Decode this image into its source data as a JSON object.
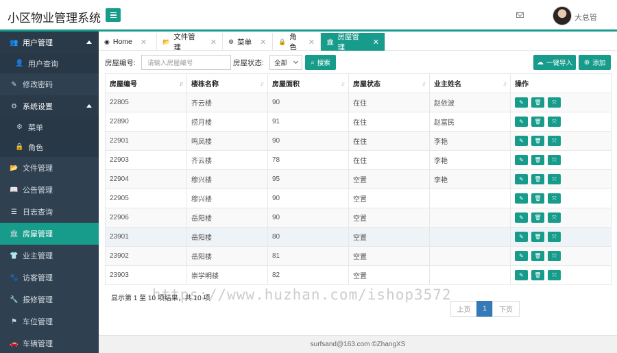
{
  "app": {
    "title": "小区物业管理系统",
    "user": "大总管"
  },
  "sidebar": {
    "items": [
      {
        "label": "用户管理",
        "icon": "users-icon",
        "glyph": "👥",
        "kind": "parent"
      },
      {
        "label": "用户查询",
        "icon": "user-icon",
        "glyph": "👤",
        "kind": "sub"
      },
      {
        "label": "修改密码",
        "icon": "edit-icon",
        "glyph": "✎",
        "kind": "item"
      },
      {
        "label": "系统设置",
        "icon": "cogs-icon",
        "glyph": "⚙",
        "kind": "parent"
      },
      {
        "label": "菜单",
        "icon": "gear-icon",
        "glyph": "⚙",
        "kind": "sub"
      },
      {
        "label": "角色",
        "icon": "lock-icon",
        "glyph": "🔒",
        "kind": "sub"
      },
      {
        "label": "文件管理",
        "icon": "folder-icon",
        "glyph": "📂",
        "kind": "item"
      },
      {
        "label": "公告管理",
        "icon": "book-icon",
        "glyph": "📖",
        "kind": "item"
      },
      {
        "label": "日志查询",
        "icon": "list-icon",
        "glyph": "☰",
        "kind": "item"
      },
      {
        "label": "房屋管理",
        "icon": "bank-icon",
        "glyph": "🏛",
        "kind": "active"
      },
      {
        "label": "业主管理",
        "icon": "person-icon",
        "glyph": "👕",
        "kind": "item"
      },
      {
        "label": "访客管理",
        "icon": "paw-icon",
        "glyph": "🐾",
        "kind": "item"
      },
      {
        "label": "报修管理",
        "icon": "wrench-icon",
        "glyph": "🔧",
        "kind": "item"
      },
      {
        "label": "车位管理",
        "icon": "flag-icon",
        "glyph": "⚑",
        "kind": "item"
      },
      {
        "label": "车辆管理",
        "icon": "car-icon",
        "glyph": "🚗",
        "kind": "item"
      }
    ]
  },
  "tabs": [
    {
      "label": "Home",
      "icon": "dashboard-icon",
      "glyph": "◉",
      "active": false
    },
    {
      "label": "文件管理",
      "icon": "folder-icon",
      "glyph": "📂",
      "active": false
    },
    {
      "label": "菜单",
      "icon": "gear-icon",
      "glyph": "⚙",
      "active": false
    },
    {
      "label": "角色",
      "icon": "lock-icon",
      "glyph": "🔒",
      "active": false
    },
    {
      "label": "房屋管理",
      "icon": "bank-icon",
      "glyph": "🏛",
      "active": true
    }
  ],
  "search": {
    "house_no_label": "房屋编号:",
    "house_no_placeholder": "请输入房屋编号",
    "status_label": "房屋状态:",
    "status_value": "全部",
    "search_button": "搜索",
    "import_button": "一键导入",
    "add_button": "添加"
  },
  "table": {
    "columns": [
      "房屋编号",
      "楼栋名称",
      "房屋面积",
      "房屋状态",
      "业主姓名",
      "操作"
    ],
    "rows": [
      [
        "22805",
        "齐云楼",
        "90",
        "在住",
        "赵依波"
      ],
      [
        "22890",
        "捞月楼",
        "91",
        "在住",
        "赵富民"
      ],
      [
        "22901",
        "鸣凤楼",
        "90",
        "在住",
        "李艳"
      ],
      [
        "22903",
        "齐云楼",
        "78",
        "在住",
        "李艳"
      ],
      [
        "22904",
        "穆兴楼",
        "95",
        "空置",
        "李艳"
      ],
      [
        "22905",
        "穆兴楼",
        "90",
        "空置",
        ""
      ],
      [
        "22906",
        "岳阳楼",
        "90",
        "空置",
        ""
      ],
      [
        "23901",
        "岳阳楼",
        "80",
        "空置",
        ""
      ],
      [
        "23902",
        "岳阳楼",
        "81",
        "空置",
        ""
      ],
      [
        "23903",
        "崇学明楼",
        "82",
        "空置",
        ""
      ]
    ]
  },
  "pagination": {
    "info": "显示第 1 至 10 项结果，共 10 项",
    "prev": "上页",
    "current": "1",
    "next": "下页"
  },
  "watermark": "https://www.huzhan.com/ishop3572",
  "footer": "surfsand@163.com ©ZhangXS",
  "colors": {
    "accent": "#179c8b",
    "sidebar": "#2f4050",
    "page_active": "#337ab7"
  }
}
